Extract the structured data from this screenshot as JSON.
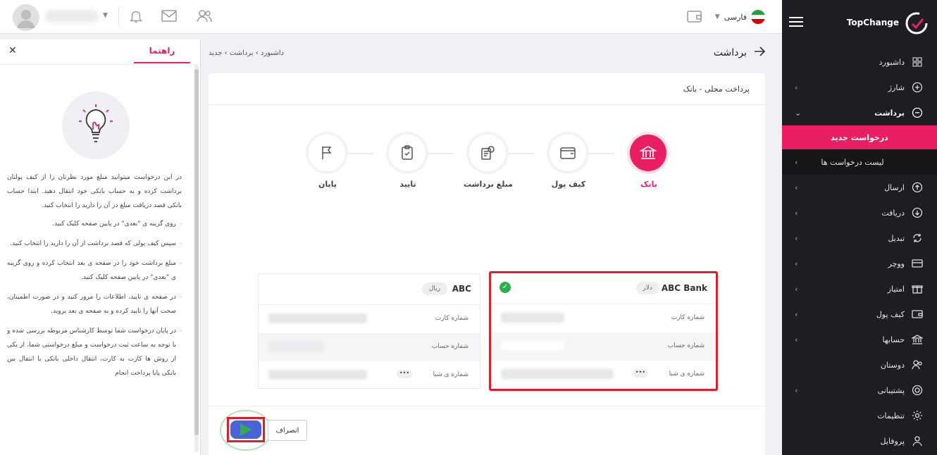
{
  "brand": {
    "name": "TopChange"
  },
  "topbar": {
    "language": "فارسی"
  },
  "sidebar": {
    "items": [
      {
        "label": "داشبورد",
        "icon": "grid-icon",
        "chevron": false
      },
      {
        "label": "شارژ",
        "icon": "plus-circle-icon",
        "chevron": true
      },
      {
        "label": "برداشت",
        "icon": "minus-circle-icon",
        "chevron": true,
        "expanded": true
      },
      {
        "label": "درخواست جدید",
        "sub": true,
        "active": true
      },
      {
        "label": "لیست درخواست ها",
        "sub": true,
        "chevron": true
      },
      {
        "label": "ارسال",
        "icon": "upload-icon",
        "chevron": true
      },
      {
        "label": "دریافت",
        "icon": "download-icon",
        "chevron": true
      },
      {
        "label": "تبدیل",
        "icon": "exchange-icon",
        "chevron": true
      },
      {
        "label": "ووچر",
        "icon": "voucher-icon",
        "chevron": true
      },
      {
        "label": "امتیاز",
        "icon": "gift-icon",
        "chevron": true
      },
      {
        "label": "کیف پول",
        "icon": "wallet-icon",
        "chevron": true
      },
      {
        "label": "حسابها",
        "icon": "bank-icon",
        "chevron": true
      },
      {
        "label": "دوستان",
        "icon": "users-icon",
        "chevron": false
      },
      {
        "label": "پشتیبانی",
        "icon": "support-icon",
        "chevron": true
      },
      {
        "label": "تنظیمات",
        "icon": "gear-icon",
        "chevron": false
      },
      {
        "label": "پروفایل",
        "icon": "user-icon",
        "chevron": false
      }
    ]
  },
  "help": {
    "tab": "راهنما",
    "intro": "در این درخواست میتوانید مبلغ مورد نظرتان را از کیف پولتان برداشت کرده و به حساب بانکی خود انتقال دهید. ابتدا حساب بانکی قصد دریافت مبلغ در آن را دارید را انتخاب کنید.",
    "bullets": [
      "روی گزینه ی \"بعدی\" در پایین صفحه کلیک کنید.",
      "سپس کیف پولی که قصد برداشت از آن را دارید را انتخاب کنید.",
      "مبلغ برداشت خود را در صفحه ی بعد انتخاب کرده و روی گزینه ی \"بعدی\" در پایین صفحه کلیک کنید.",
      "در صفحه ی تایید، اطلاعات را مرور کنید و در صورت اطمینان، صحت آنها را تایید کرده و به صفحه ی بعد بروید.",
      "در پایان درخواست شما توسط کارشناس مربوطه بررسی شده و با توجه به ساعت ثبت درخواست و مبلغ درخواستی شما، از یکی از روش ها کارت به کارت، انتقال داخلی بانکی یا انتقال بین بانکی پایا پرداخت انجام"
    ]
  },
  "page": {
    "title": "برداشت",
    "breadcrumb": "داشبورد  ›  برداشت  ›  جدید",
    "card_title": "پرداخت محلی - بانک"
  },
  "steps": [
    {
      "label": "بانک",
      "icon": "bank-icon",
      "active": true
    },
    {
      "label": "کیف پول",
      "icon": "wallet-icon"
    },
    {
      "label": "مبلغ برداشت",
      "icon": "document-icon"
    },
    {
      "label": "تایید",
      "icon": "clipboard-check-icon"
    },
    {
      "label": "پایان",
      "icon": "flag-icon"
    }
  ],
  "accounts": [
    {
      "bank": "ABC Bank",
      "currency": "دلار",
      "selected": true,
      "card_label": "شماره کارت",
      "account_label": "شماره حساب",
      "sheba_label": "شماره ی شبا",
      "dots": "•••"
    },
    {
      "bank": "ABC",
      "currency": "ریال",
      "selected": false,
      "card_label": "شماره کارت",
      "account_label": "شماره حساب",
      "sheba_label": "شماره ی شبا",
      "dots": "•••"
    }
  ],
  "buttons": {
    "cancel": "انصراف"
  },
  "colors": {
    "accent": "#e91e63",
    "sidebar": "#1e1e22",
    "highlight": "#e11d2a",
    "success": "#2eae4e"
  }
}
